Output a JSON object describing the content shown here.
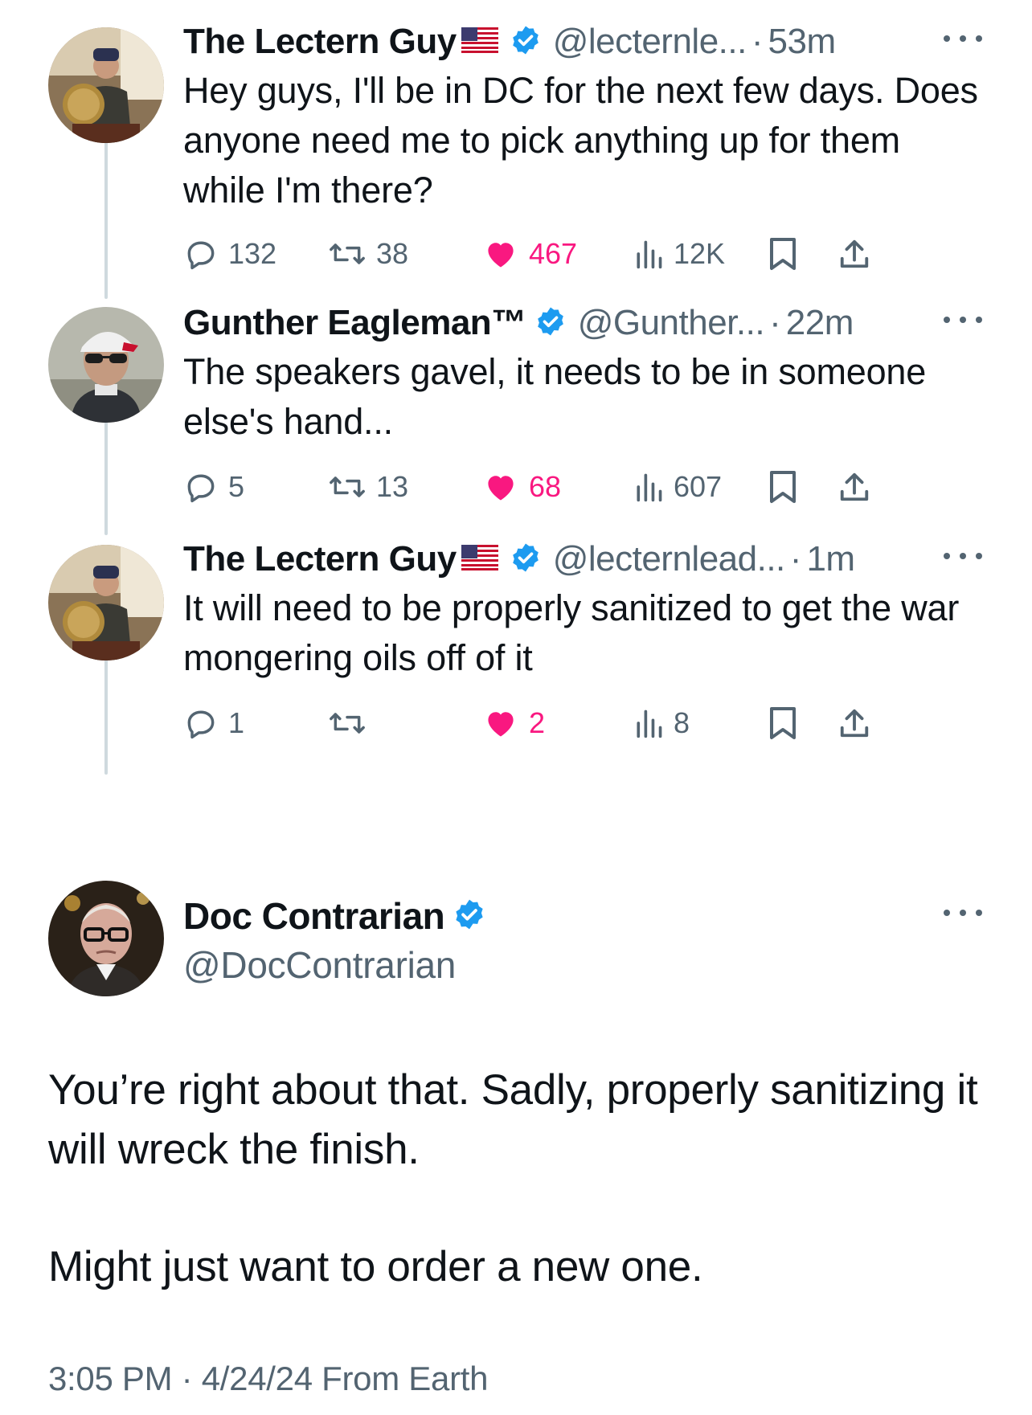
{
  "replies": [
    {
      "author": "The Lectern Guy",
      "handle": "@lecternle...",
      "time": "53m",
      "text": "Hey guys, I'll be in DC for the next few days. Does anyone need me to pick anything up for them while I'm there?",
      "stats": {
        "replies": "132",
        "reposts": "38",
        "likes": "467",
        "views": "12K"
      },
      "has_flag": true
    },
    {
      "author": "Gunther Eagleman™",
      "handle": "@Gunther...",
      "time": "22m",
      "text": "The speakers gavel,  it needs to be in someone else's hand...",
      "stats": {
        "replies": "5",
        "reposts": "13",
        "likes": "68",
        "views": "607"
      },
      "has_flag": false
    },
    {
      "author": "The Lectern Guy",
      "handle": "@lecternlead...",
      "time": "1m",
      "text": "It will need to be properly sanitized to get the war mongering oils off of it",
      "stats": {
        "replies": "1",
        "reposts": "",
        "likes": "2",
        "views": "8"
      },
      "has_flag": true
    }
  ],
  "main_tweet": {
    "author": "Doc Contrarian",
    "handle": "@DocContrarian",
    "paragraph1": "You’re right about that. Sadly, properly sanitizing it will wreck the finish.",
    "paragraph2": "Might just want to order a new one.",
    "timestamp": "3:05 PM · 4/24/24 From Earth"
  },
  "separator": "·",
  "icons": [
    "reply-icon",
    "repost-icon",
    "like-icon",
    "views-icon",
    "bookmark-icon",
    "share-icon",
    "verified-badge-icon",
    "us-flag-icon",
    "more-icon"
  ],
  "colors": {
    "like": "#f91880",
    "verified": "#1d9bf0",
    "secondary_text": "#536471",
    "thread_line": "#cfd9de"
  }
}
